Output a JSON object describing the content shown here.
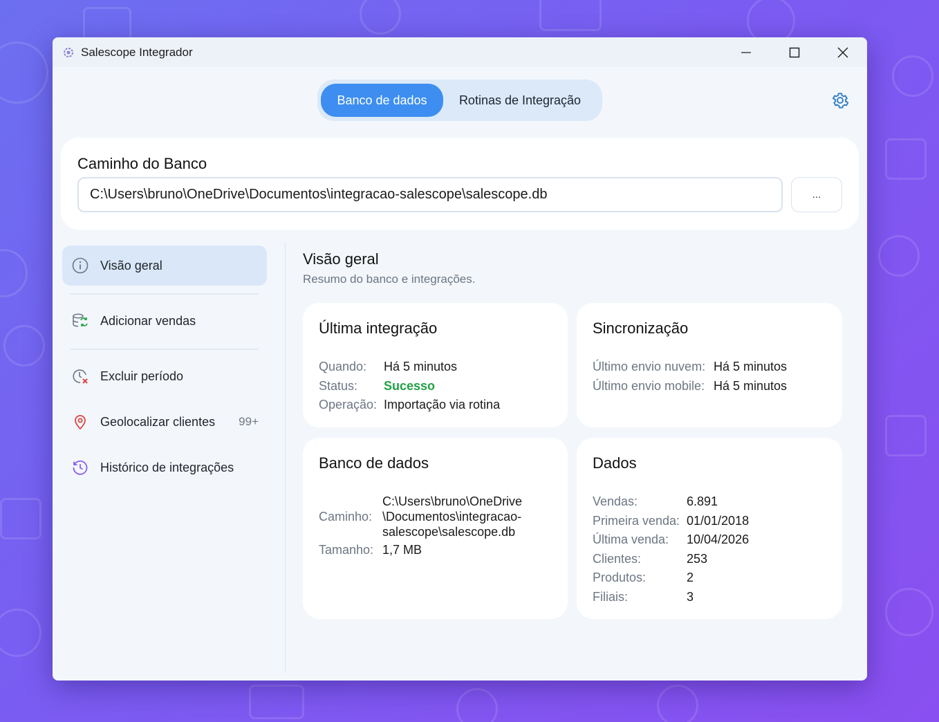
{
  "window": {
    "title": "Salescope Integrador"
  },
  "tabs": [
    {
      "label": "Banco de dados",
      "active": true
    },
    {
      "label": "Rotinas de Integração",
      "active": false
    }
  ],
  "path_section": {
    "title": "Caminho do Banco",
    "value": "C:\\Users\\bruno\\OneDrive\\Documentos\\integracao-salescope\\salescope.db",
    "browse_label": "..."
  },
  "sidebar": {
    "items": [
      {
        "label": "Visão geral",
        "icon": "info-icon",
        "active": true
      },
      {
        "label": "Adicionar vendas",
        "icon": "database-sync-icon"
      },
      {
        "label": "Excluir período",
        "icon": "clock-delete-icon"
      },
      {
        "label": "Geolocalizar clientes",
        "icon": "map-pin-icon",
        "badge": "99+"
      },
      {
        "label": "Histórico de integrações",
        "icon": "history-icon"
      }
    ]
  },
  "main": {
    "title": "Visão geral",
    "subtitle": "Resumo do banco e integrações."
  },
  "cards": {
    "ultima": {
      "title": "Última integração",
      "rows": [
        {
          "k": "Quando:",
          "v": "Há 5 minutos"
        },
        {
          "k": "Status:",
          "v": "Sucesso"
        },
        {
          "k": "Operação:",
          "v": "Importação via rotina"
        }
      ]
    },
    "sync": {
      "title": "Sincronização",
      "rows": [
        {
          "k": "Último envio nuvem:",
          "v": "Há 5 minutos"
        },
        {
          "k": "Último envio mobile:",
          "v": "Há 5 minutos"
        }
      ]
    },
    "banco": {
      "title": "Banco de dados",
      "rows": [
        {
          "k": "Caminho:",
          "v1": "C:\\Users\\bruno\\OneDrive",
          "v2": "\\Documentos\\integracao-",
          "v3": "salescope\\salescope.db"
        },
        {
          "k": "Tamanho:",
          "v": "1,7 MB"
        }
      ]
    },
    "dados": {
      "title": "Dados",
      "rows": [
        {
          "k": "Vendas:",
          "v": "6.891"
        },
        {
          "k": "Primeira venda:",
          "v": "01/01/2018"
        },
        {
          "k": "Última venda:",
          "v": "10/04/2026"
        },
        {
          "k": "Clientes:",
          "v": "253"
        },
        {
          "k": "Produtos:",
          "v": "2"
        },
        {
          "k": "Filiais:",
          "v": "3"
        }
      ]
    }
  },
  "colors": {
    "accent": "#3d8ef0",
    "success": "#21a145",
    "background_gradient_start": "#6c6ff0",
    "background_gradient_end": "#8a4ff0"
  }
}
